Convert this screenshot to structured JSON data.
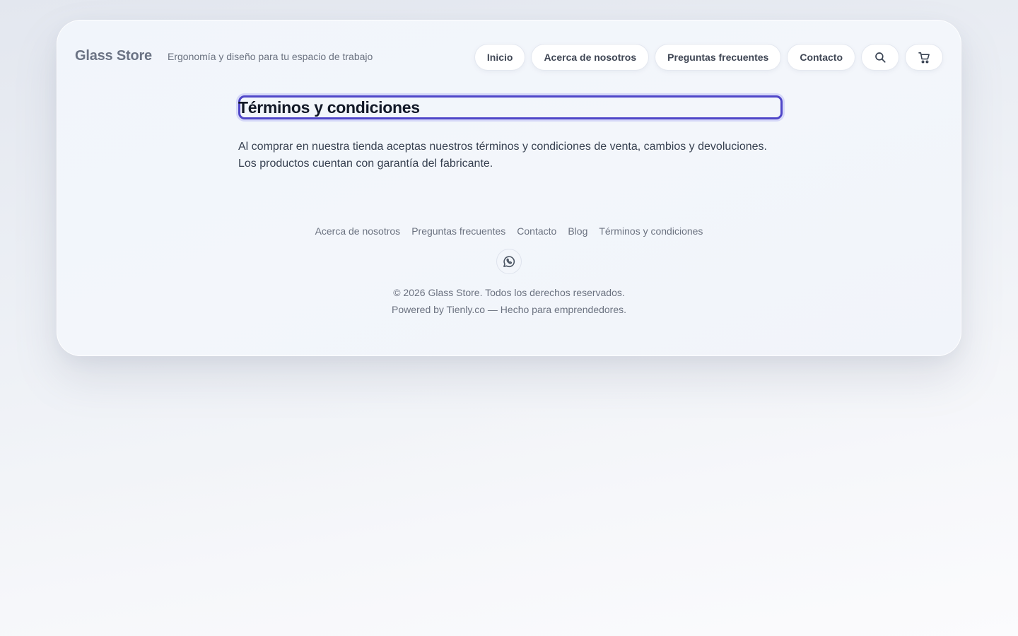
{
  "header": {
    "brand": "Glass Store",
    "tagline": "Ergonomía y diseño para tu espacio de trabajo",
    "nav": [
      {
        "label": "Inicio"
      },
      {
        "label": "Acerca de nosotros"
      },
      {
        "label": "Preguntas frecuentes"
      },
      {
        "label": "Contacto"
      }
    ],
    "icons": [
      "search-icon",
      "cart-icon"
    ]
  },
  "main": {
    "title": "Términos y condiciones",
    "body_line1": "Al comprar en nuestra tienda aceptas nuestros términos y condiciones de venta, cambios y devoluciones.",
    "body_line2": "Los productos cuentan con garantía del fabricante."
  },
  "footer": {
    "links": [
      {
        "label": "Acerca de nosotros"
      },
      {
        "label": "Preguntas frecuentes"
      },
      {
        "label": "Contacto"
      },
      {
        "label": "Blog"
      },
      {
        "label": "Términos y condiciones"
      }
    ],
    "social_icon": "whatsapp-icon",
    "copyright": "© 2026 Glass Store. Todos los derechos reservados.",
    "powered": "Powered by Tienly.co — Hecho para emprendedores."
  },
  "colors": {
    "accent": "#4f46c8",
    "text_dark": "#111827",
    "text_muted": "#6b7280"
  }
}
